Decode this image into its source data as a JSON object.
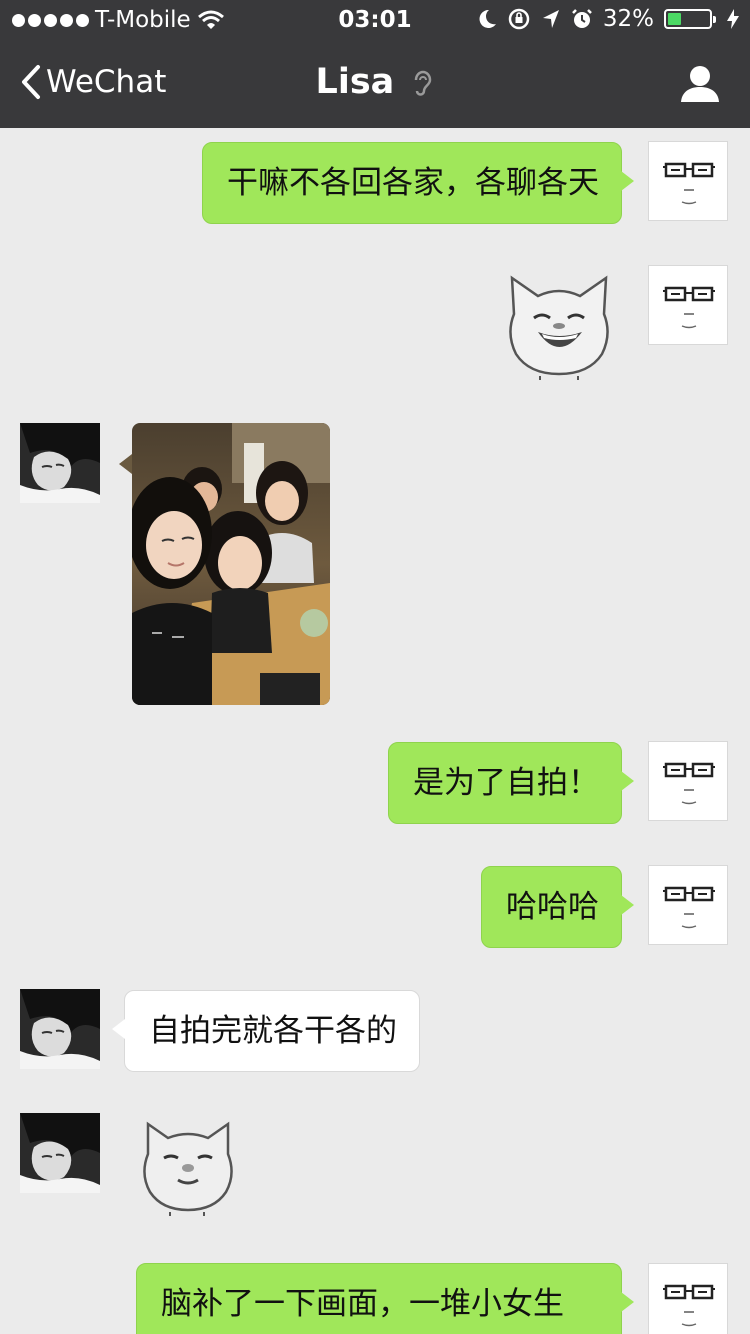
{
  "status_bar": {
    "carrier": "T-Mobile",
    "time": "03:01",
    "battery_percent": "32%",
    "battery_level": 0.32,
    "icons": [
      "signal-dots-icon",
      "wifi-icon",
      "moon-icon",
      "rotation-lock-icon",
      "location-arrow-icon",
      "alarm-icon",
      "battery-icon",
      "charging-bolt-icon"
    ]
  },
  "nav": {
    "back_label": "WeChat",
    "title": "Lisa",
    "icons": [
      "chevron-left-icon",
      "earpiece-icon",
      "profile-icon"
    ]
  },
  "messages": [
    {
      "from": "me",
      "type": "text",
      "text": "干嘛不各回各家，各聊各天"
    },
    {
      "from": "me",
      "type": "sticker",
      "sticker": "laughing-cat-face-sticker"
    },
    {
      "from": "lisa",
      "type": "photo",
      "photo": "group-selfie-photo"
    },
    {
      "from": "me",
      "type": "text",
      "text": "是为了自拍！"
    },
    {
      "from": "me",
      "type": "text",
      "text": "哈哈哈"
    },
    {
      "from": "lisa",
      "type": "text",
      "text": "自拍完就各干各的"
    },
    {
      "from": "lisa",
      "type": "sticker",
      "sticker": "squinting-cat-face-sticker"
    },
    {
      "from": "me",
      "type": "text",
      "text": "脑补了一下画面，一堆小女生"
    }
  ],
  "colors": {
    "nav_bg": "#39393b",
    "chat_bg": "#ebebeb",
    "outgoing_bubble": "#a0e75a",
    "incoming_bubble": "#ffffff",
    "battery_fill": "#4cd964"
  }
}
